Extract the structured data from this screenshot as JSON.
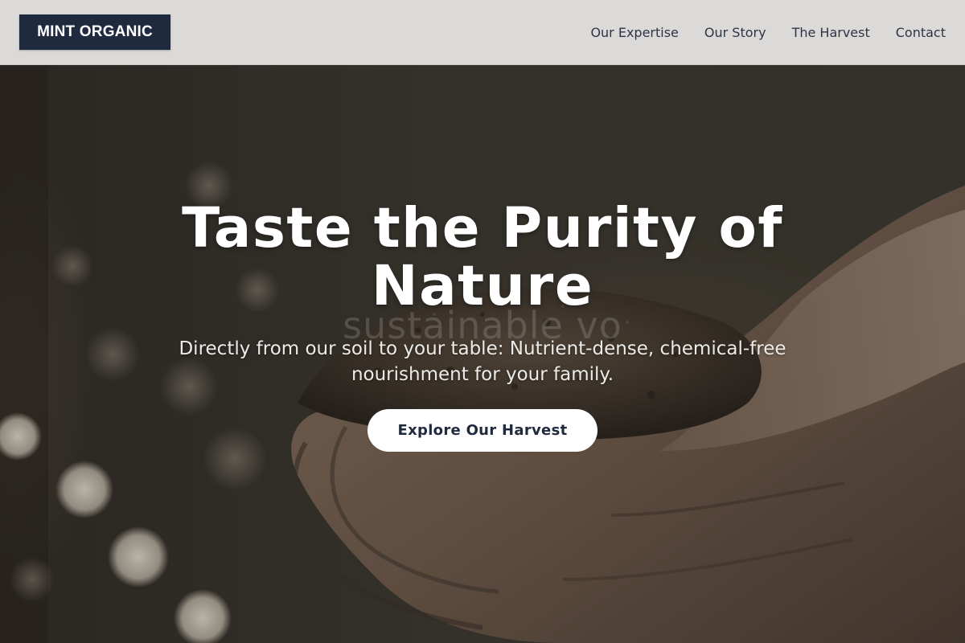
{
  "brand": {
    "logo_text": "MINT ORGANIC",
    "logo_bg": "#1f2a3f"
  },
  "nav": {
    "items": [
      {
        "label": "Our Expertise"
      },
      {
        "label": "Our Story"
      },
      {
        "label": "The Harvest"
      },
      {
        "label": "Contact"
      }
    ]
  },
  "hero": {
    "title": "Taste the Purity of Nature",
    "subtitle": "Directly from our soil to your table: Nutrient-dense, chemical-free nourishment for your family.",
    "cta_label": "Explore Our Harvest",
    "watermark": "sustainable vo",
    "image": {
      "subject": "hands holding soil"
    }
  },
  "colors": {
    "header_bg": "#dcdad9",
    "text_dark": "#2d3444",
    "cta_bg": "#ffffff"
  }
}
